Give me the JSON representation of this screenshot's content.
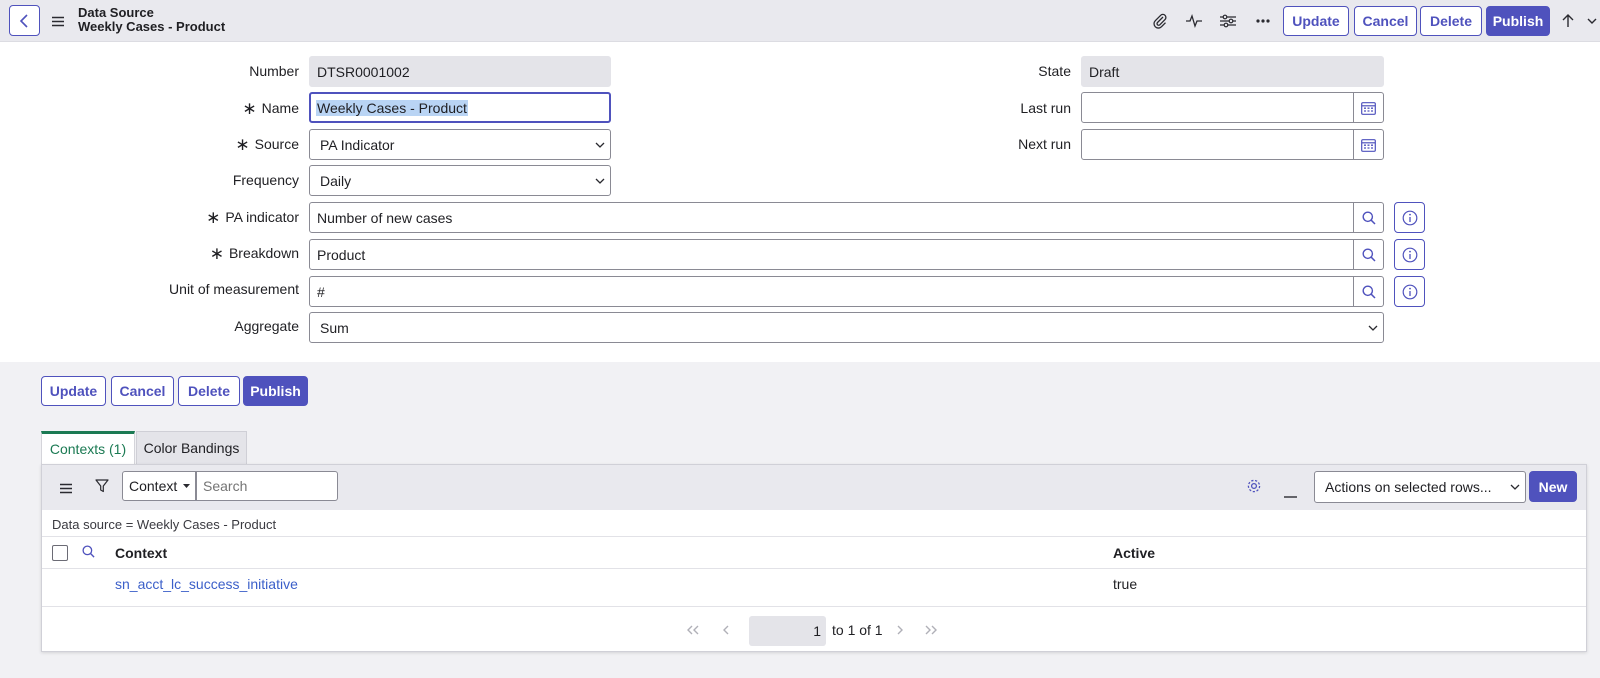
{
  "header": {
    "title_line1": "Data Source",
    "title_line2": "Weekly Cases - Product",
    "buttons": {
      "update": "Update",
      "cancel": "Cancel",
      "delete": "Delete",
      "publish": "Publish"
    }
  },
  "form": {
    "number": {
      "label": "Number",
      "value": "DTSR0001002"
    },
    "name": {
      "label": "Name",
      "value": "Weekly Cases - Product"
    },
    "source": {
      "label": "Source",
      "value": "PA Indicator"
    },
    "frequency": {
      "label": "Frequency",
      "value": "Daily"
    },
    "pa_indicator": {
      "label": "PA indicator",
      "value": "Number of new cases"
    },
    "breakdown": {
      "label": "Breakdown",
      "value": "Product"
    },
    "unit": {
      "label": "Unit of measurement",
      "value": "#"
    },
    "aggregate": {
      "label": "Aggregate",
      "value": "Sum"
    },
    "state": {
      "label": "State",
      "value": "Draft"
    },
    "last_run": {
      "label": "Last run",
      "value": ""
    },
    "next_run": {
      "label": "Next run",
      "value": ""
    },
    "required_mark": "∗"
  },
  "form_buttons": {
    "update": "Update",
    "cancel": "Cancel",
    "delete": "Delete",
    "publish": "Publish"
  },
  "tabs": [
    {
      "label": "Contexts (1)"
    },
    {
      "label": "Color Bandings"
    }
  ],
  "list": {
    "search_field": "Context",
    "search_placeholder": "Search",
    "actions_select": "Actions on selected rows...",
    "new_button": "New",
    "filter": "Data source = Weekly Cases - Product",
    "columns": [
      "Context",
      "Active"
    ],
    "rows": [
      {
        "context": "sn_acct_lc_success_initiative",
        "active": "true"
      }
    ],
    "pager": {
      "current": "1",
      "range_text": "to 1 of 1"
    }
  },
  "colors": {
    "accent": "#4f52bd",
    "tab_active": "#1b7a53",
    "link": "#3b5fc9"
  }
}
